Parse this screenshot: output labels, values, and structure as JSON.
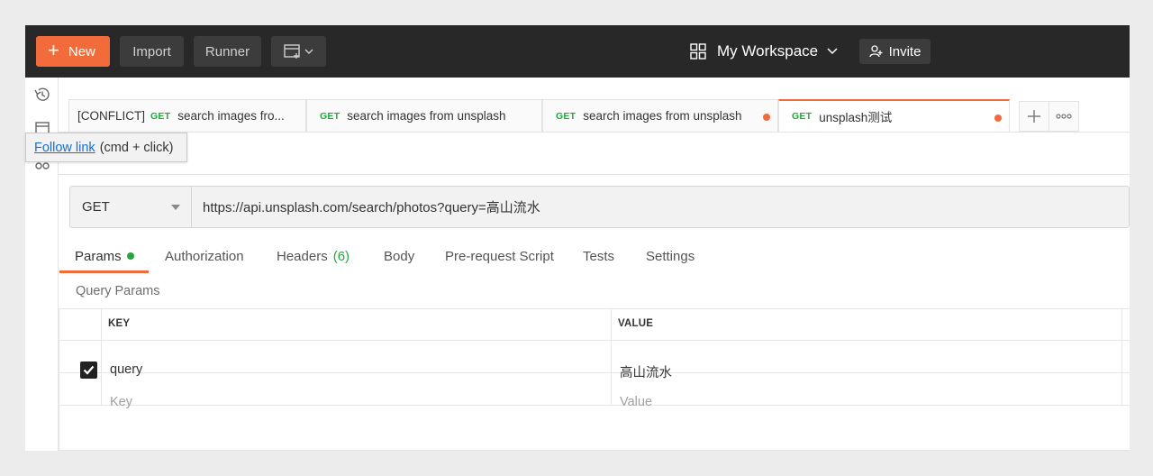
{
  "topbar": {
    "new_label": "New",
    "import_label": "Import",
    "runner_label": "Runner",
    "workspace_label": "My Workspace",
    "invite_label": "Invite"
  },
  "tabs": [
    {
      "prefix": "[CONFLICT]",
      "method": "GET",
      "label": "search images fro...",
      "unsaved": false,
      "active": false
    },
    {
      "prefix": "",
      "method": "GET",
      "label": "search images from unsplash",
      "unsaved": false,
      "active": false
    },
    {
      "prefix": "",
      "method": "GET",
      "label": "search images from unsplash",
      "unsaved": true,
      "active": false
    },
    {
      "prefix": "",
      "method": "GET",
      "label": "unsplash测试",
      "unsaved": true,
      "active": true
    }
  ],
  "request": {
    "method": "GET",
    "url": "https://api.unsplash.com/search/photos?query=高山流水"
  },
  "request_tabs": {
    "params": "Params",
    "authorization": "Authorization",
    "headers": "Headers",
    "headers_count": "(6)",
    "body": "Body",
    "prerequest": "Pre-request Script",
    "tests": "Tests",
    "settings": "Settings"
  },
  "query_params": {
    "title": "Query Params",
    "key_header": "KEY",
    "value_header": "VALUE",
    "rows": [
      {
        "key": "query",
        "value": "高山流水",
        "checked": true
      }
    ],
    "key_placeholder": "Key",
    "value_placeholder": "Value"
  },
  "tooltip": {
    "link_text": "Follow link",
    "hint": "(cmd + click)"
  },
  "colors": {
    "accent": "#f26b3a",
    "method_get": "#27a541",
    "topbar_bg": "#282828"
  }
}
